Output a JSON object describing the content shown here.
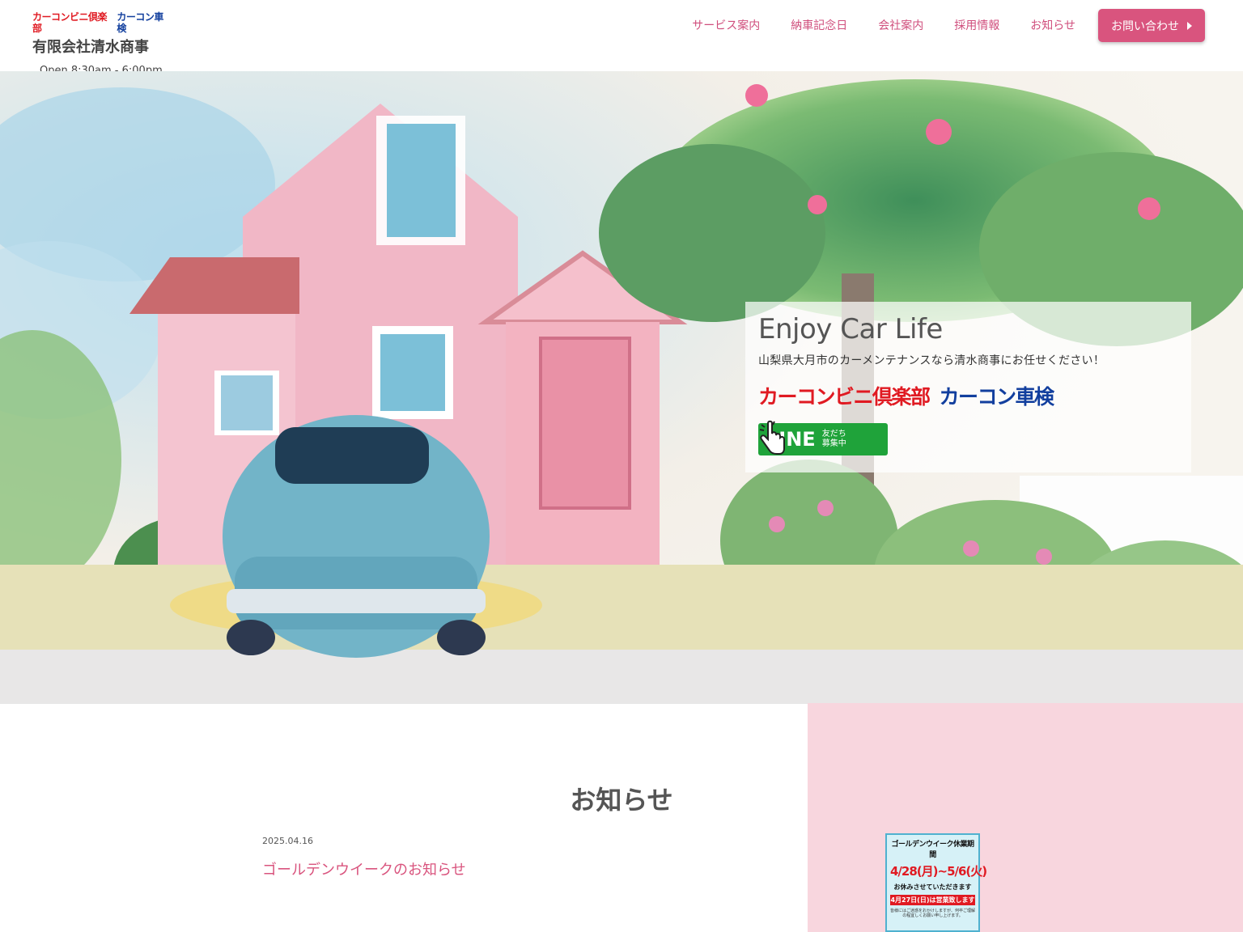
{
  "header": {
    "brand_red": "カーコンビニ倶楽部",
    "brand_blue": "カーコン車検",
    "company": "有限会社清水商事",
    "hours": "Open 8:30am - 6:00pm",
    "nav": [
      "サービス案内",
      "納車記念日",
      "会社案内",
      "採用情報",
      "お知らせ"
    ],
    "contact_label": "お問い合わせ"
  },
  "hero": {
    "title": "Enjoy Car Life",
    "subtitle": "山梨県大月市のカーメンテナンスなら清水商事にお任せください！",
    "brand_red": "カーコンビニ倶楽部",
    "brand_blue": "カーコン車検",
    "line_word": "LINE",
    "line_small_1": "友だち",
    "line_small_2": "募集中"
  },
  "news": {
    "heading": "お知らせ",
    "date": "2025.04.16",
    "title": "ゴールデンウイークのお知らせ"
  },
  "poster": {
    "title": "ゴールデンウイーク休業期間",
    "dates": "4/28(月)~5/6(火)",
    "rest": "お休みさせていただきます",
    "open": "4月27日(日)は営業致します",
    "note": "皆様にはご迷惑をおかけしますが、何卒ご理解の程宜しくお願い申し上げます。"
  },
  "colors": {
    "accent_pink": "#d9547e",
    "brand_red": "#e01a22",
    "brand_blue": "#123f9e",
    "line_green": "#1fa33a",
    "panel_pink": "#f8d6de"
  }
}
